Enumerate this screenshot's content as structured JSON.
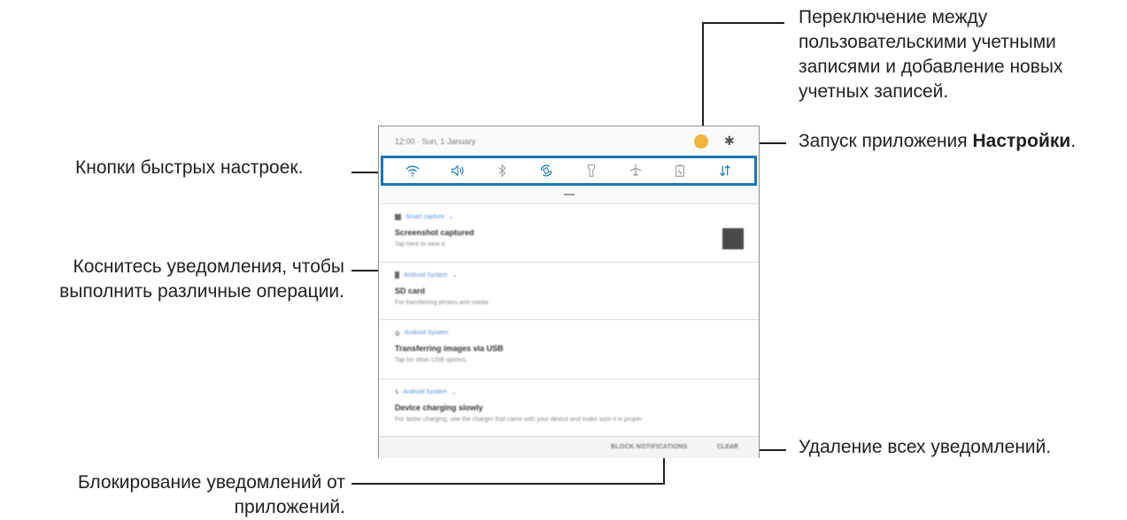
{
  "callouts": {
    "accounts": "Переключение между пользовательскими учетными записями и добавление новых учетных записей.",
    "settings_prefix": "Запуск приложения ",
    "settings_bold": "Настройки",
    "settings_suffix": ".",
    "quick_buttons": "Кнопки быстрых настроек.",
    "tap_notification": "Коснитесь уведомления, чтобы выполнить различные операции.",
    "clear_all": "Удаление всех уведомлений.",
    "block": "Блокирование уведомлений от приложений."
  },
  "panel": {
    "datetime": "12:00 · Sun, 1 January",
    "quick_settings": [
      "wifi-icon",
      "sound-icon",
      "bluetooth-icon",
      "auto-rotate-icon",
      "flashlight-icon",
      "airplane-mode-icon",
      "power-saving-icon",
      "mobile-data-icon"
    ],
    "notifications": [
      {
        "app": "Smart capture",
        "title": "Screenshot captured",
        "sub": "Tap here to view it."
      },
      {
        "app": "Android System",
        "title": "SD card",
        "sub": "For transferring photos and media"
      },
      {
        "app": "Android System",
        "title": "Transferring images via USB",
        "sub": "Tap for other USB options."
      },
      {
        "app": "Android System",
        "title": "Device charging slowly",
        "sub": "For faster charging, use the charger that came with your device and make sure it is proper."
      }
    ],
    "block_label": "BLOCK NOTIFICATIONS",
    "clear_label": "CLEAR"
  },
  "colors": {
    "accent": "#1875b5",
    "avatar": "#f1b33c"
  }
}
